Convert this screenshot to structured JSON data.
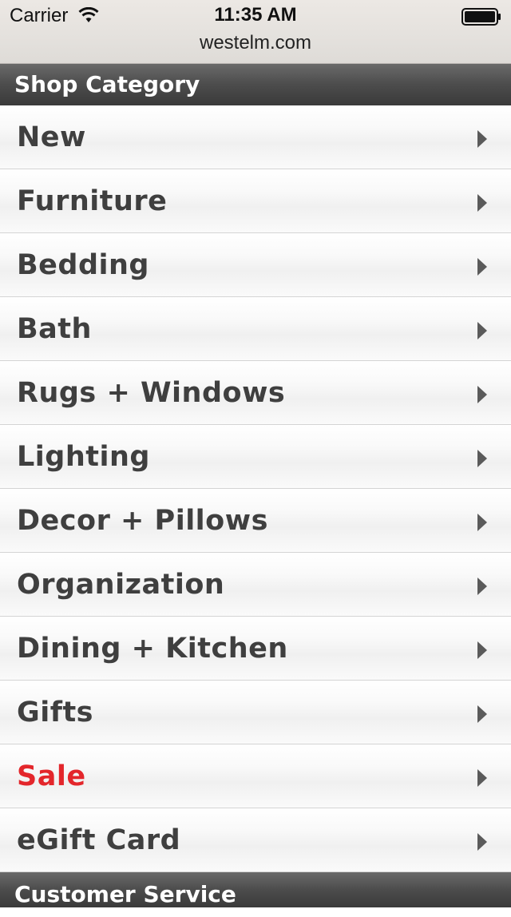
{
  "status_bar": {
    "carrier": "Carrier",
    "time": "11:35 AM",
    "url": "westelm.com",
    "wifi_icon": "wifi-icon",
    "battery_icon": "battery-full-icon"
  },
  "shop_header": {
    "title": "Shop Category"
  },
  "categories": [
    {
      "label": "New"
    },
    {
      "label": "Furniture"
    },
    {
      "label": "Bedding"
    },
    {
      "label": "Bath"
    },
    {
      "label": "Rugs + Windows"
    },
    {
      "label": "Lighting"
    },
    {
      "label": "Decor + Pillows"
    },
    {
      "label": "Organization"
    },
    {
      "label": "Dining + Kitchen"
    },
    {
      "label": "Gifts"
    },
    {
      "label": "Sale",
      "color": "#e3262b"
    },
    {
      "label": "eGift Card"
    }
  ],
  "customer_service_header": {
    "title": "Customer Service"
  },
  "colors": {
    "header_bg": "#4c4c4c",
    "item_text": "#3f3f3f",
    "sale_text": "#e3262b"
  }
}
